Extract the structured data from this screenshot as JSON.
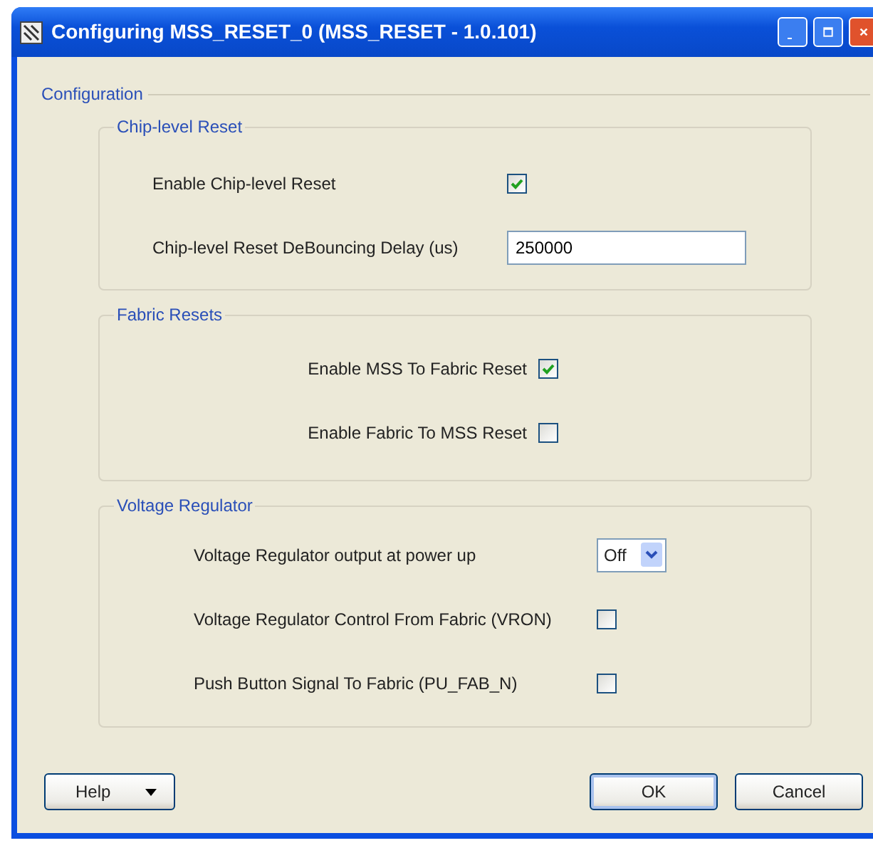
{
  "window": {
    "title": "Configuring MSS_RESET_0 (MSS_RESET - 1.0.101)"
  },
  "configuration": {
    "legend": "Configuration",
    "groups": [
      {
        "title": "Chip-level Reset",
        "fields": [
          {
            "kind": "checkbox",
            "label": "Enable Chip-level Reset",
            "checked": true
          },
          {
            "kind": "text",
            "label": "Chip-level Reset DeBouncing Delay (us)",
            "value": "250000"
          }
        ]
      },
      {
        "title": "Fabric Resets",
        "fields": [
          {
            "kind": "checkbox",
            "label": "Enable MSS To Fabric Reset",
            "checked": true
          },
          {
            "kind": "checkbox",
            "label": "Enable Fabric To MSS Reset",
            "checked": false
          }
        ]
      },
      {
        "title": "Voltage Regulator",
        "fields": [
          {
            "kind": "select",
            "label": "Voltage Regulator output at power up",
            "value": "Off"
          },
          {
            "kind": "checkbox",
            "label": "Voltage Regulator Control From Fabric (VRON)",
            "checked": false
          },
          {
            "kind": "checkbox",
            "label": "Push Button Signal To Fabric (PU_FAB_N)",
            "checked": false
          }
        ]
      }
    ]
  },
  "buttons": [
    {
      "label": "Help",
      "kind": "menu"
    },
    {
      "label": "OK",
      "kind": "default"
    },
    {
      "label": "Cancel",
      "kind": "plain"
    }
  ]
}
